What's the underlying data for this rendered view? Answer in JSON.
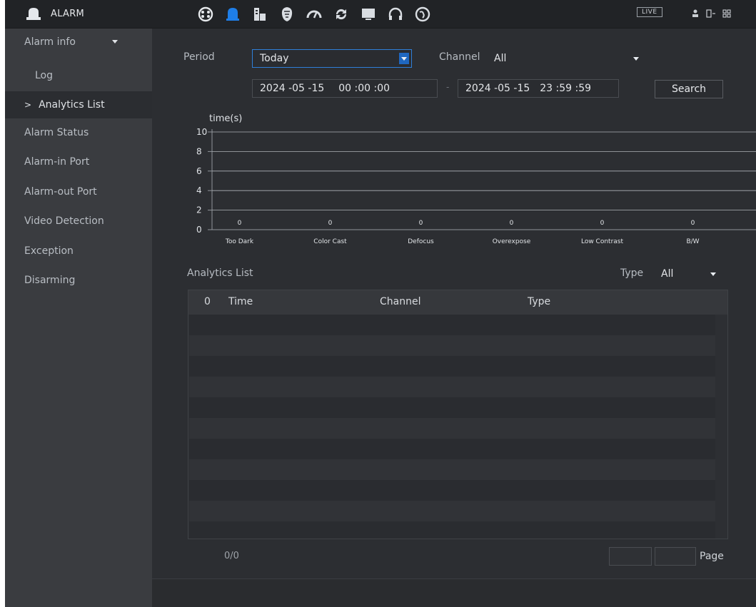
{
  "app": {
    "title": "ALARM",
    "live_label": "LIVE",
    "top_icons": [
      "playback-icon",
      "alarm-icon",
      "ai-icon",
      "face-icon",
      "speed-icon",
      "backup-icon",
      "display-icon",
      "audio-icon",
      "network-icon"
    ]
  },
  "sidebar": {
    "items": [
      {
        "label": "Alarm info",
        "type": "group"
      },
      {
        "label": "Log",
        "type": "sub"
      },
      {
        "label": "Analytics List",
        "type": "active"
      },
      {
        "label": "Alarm Status",
        "type": "item"
      },
      {
        "label": "Alarm-in Port",
        "type": "item"
      },
      {
        "label": "Alarm-out Port",
        "type": "item"
      },
      {
        "label": "Video Detection",
        "type": "item"
      },
      {
        "label": "Exception",
        "type": "item"
      },
      {
        "label": "Disarming",
        "type": "item"
      }
    ]
  },
  "filters": {
    "period_label": "Period",
    "period_value": "Today",
    "channel_label": "Channel",
    "channel_value": "All",
    "start_date": "2024 -05 -15",
    "start_time": "00 :00 :00",
    "separator": "-",
    "end_date": "2024 -05 -15",
    "end_time": "23 :59 :59",
    "search_button": "Search"
  },
  "chart_data": {
    "type": "bar",
    "ylabel": "time(s)",
    "ylim": [
      0,
      10
    ],
    "y_ticks": [
      0,
      2,
      4,
      6,
      8,
      10
    ],
    "categories": [
      "Too Dark",
      "Color Cast",
      "Defocus",
      "Overexpose",
      "Low Contrast",
      "B/W"
    ],
    "values": [
      0,
      0,
      0,
      0,
      0,
      0
    ],
    "grid": true
  },
  "list": {
    "title": "Analytics List",
    "type_label": "Type",
    "type_value": "All",
    "columns": [
      "0",
      "Time",
      "Channel",
      "Type"
    ],
    "row_count": 0,
    "count_text": "0/0",
    "page_label": "Page"
  }
}
